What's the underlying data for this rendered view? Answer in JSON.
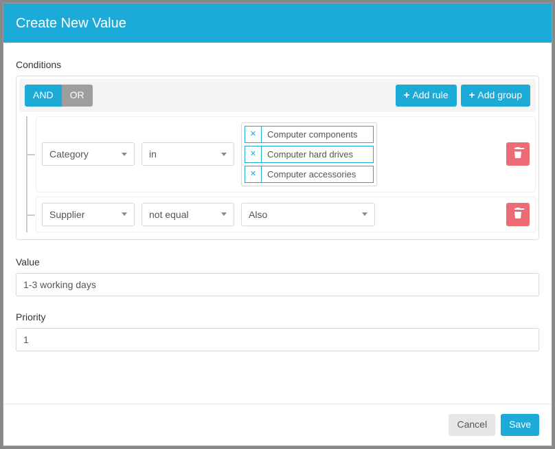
{
  "modal": {
    "title": "Create New Value"
  },
  "labels": {
    "conditions": "Conditions",
    "value": "Value",
    "priority": "Priority"
  },
  "qb": {
    "and": "AND",
    "or": "OR",
    "add_rule": "Add rule",
    "add_group": "Add group"
  },
  "rules": [
    {
      "field": "Category",
      "operator": "in",
      "tags": [
        "Computer components",
        "Computer hard drives",
        "Computer accessories"
      ]
    },
    {
      "field": "Supplier",
      "operator": "not equal",
      "value": "Also"
    }
  ],
  "form": {
    "value": "1-3 working days",
    "priority": "1"
  },
  "footer": {
    "cancel": "Cancel",
    "save": "Save"
  }
}
